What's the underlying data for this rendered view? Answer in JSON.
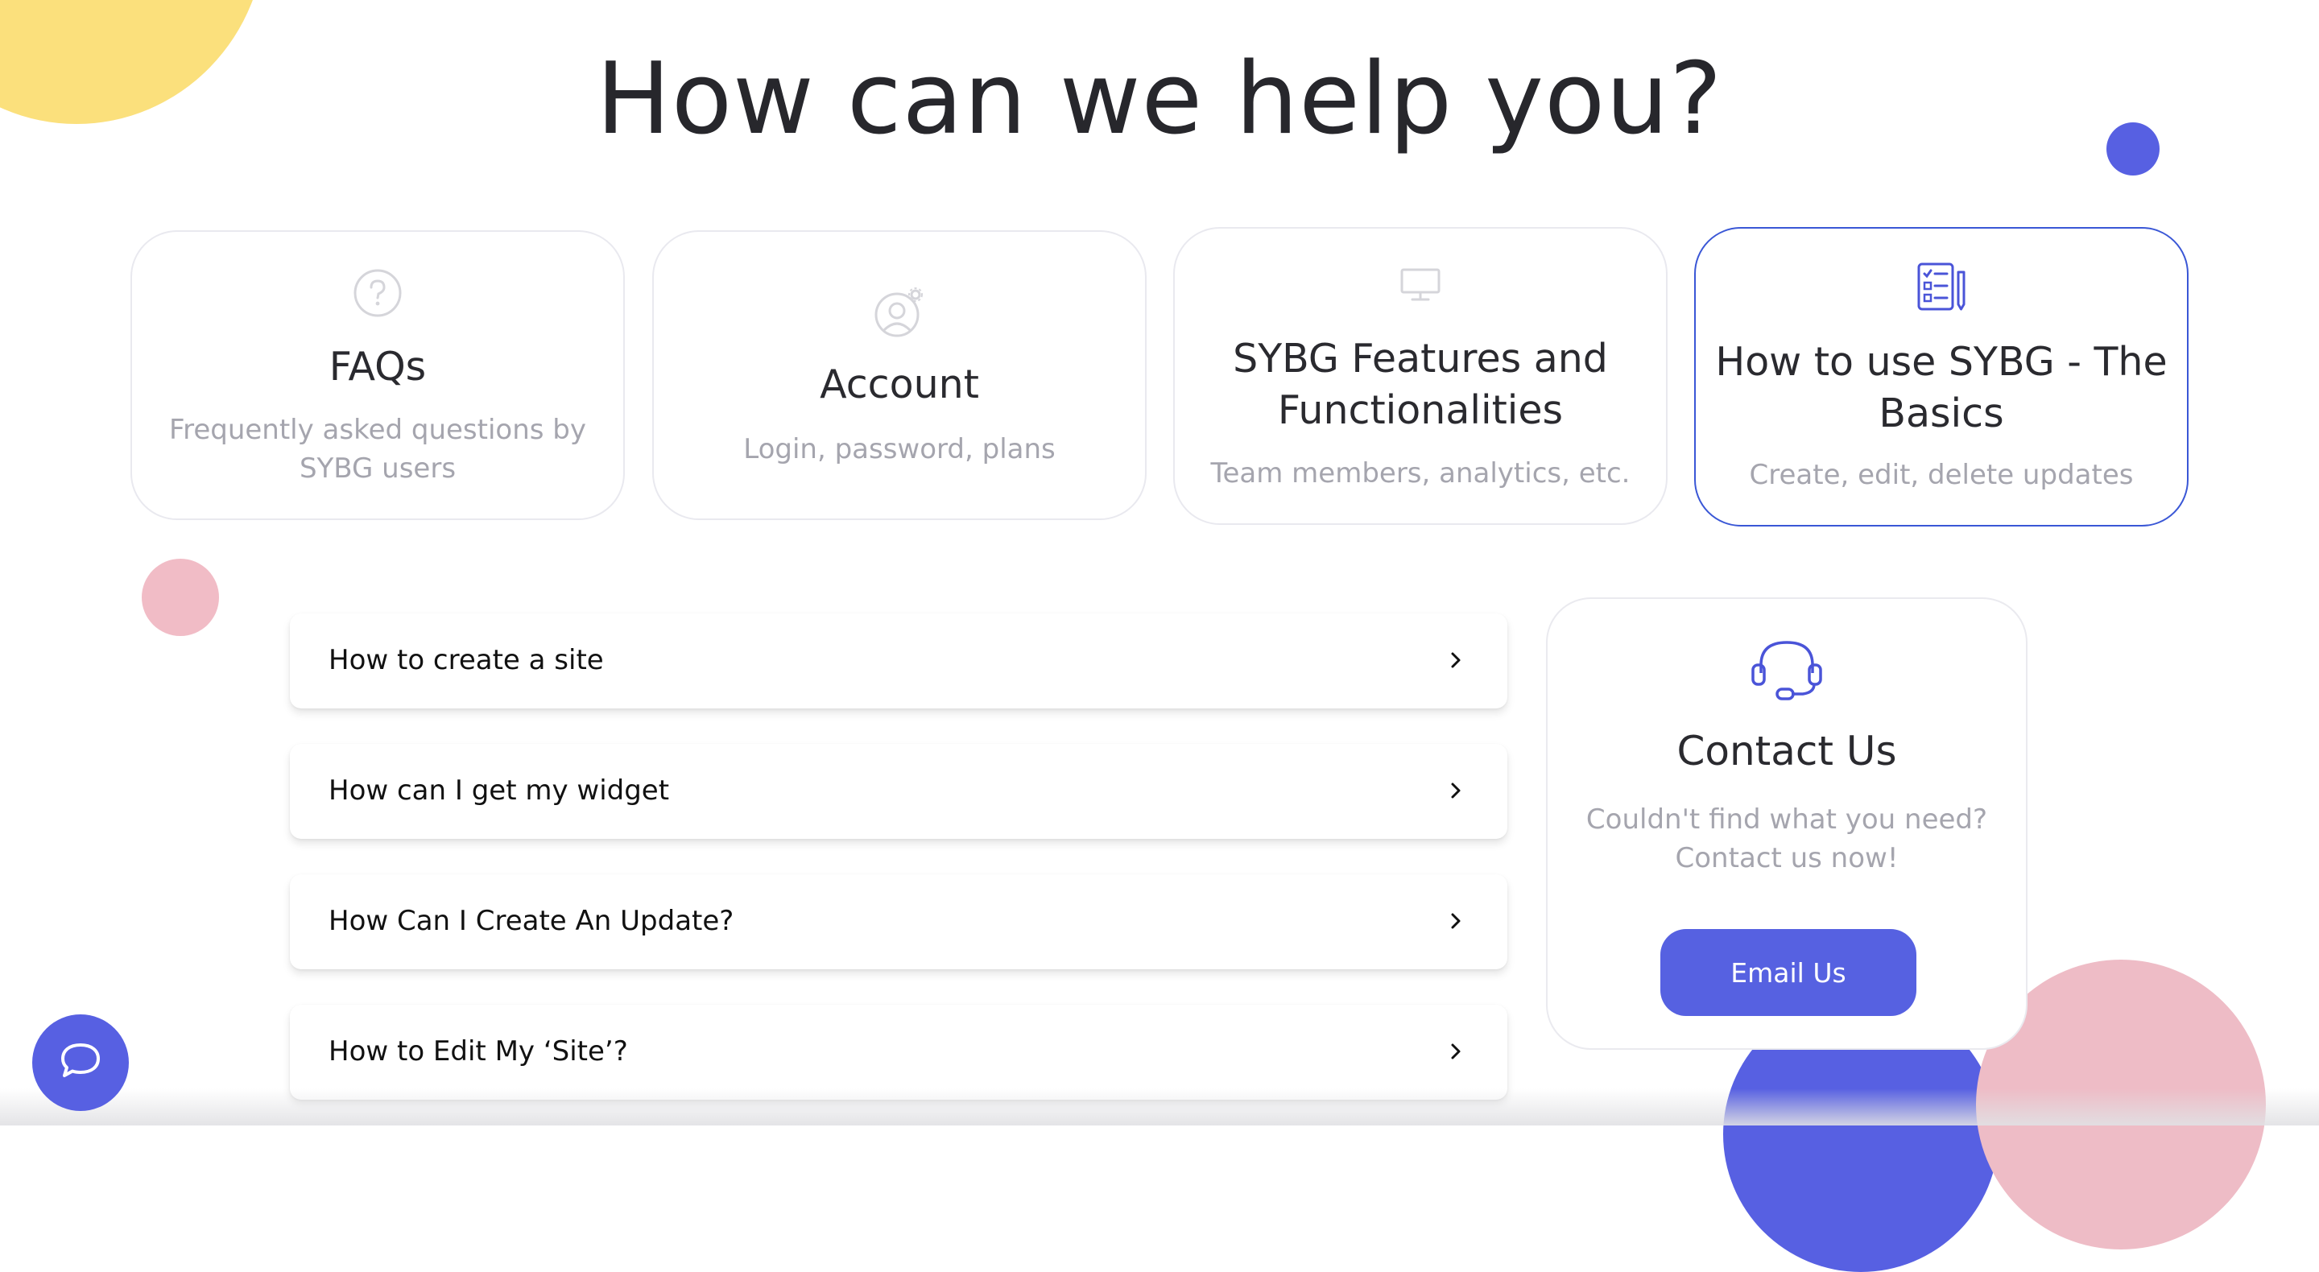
{
  "page": {
    "title": "How can we help you?"
  },
  "categories": [
    {
      "icon": "question-circle-icon",
      "title": "FAQs",
      "subtitle": "Frequently asked questions by SYBG users",
      "active": false
    },
    {
      "icon": "user-settings-icon",
      "title": "Account",
      "subtitle": "Login, password, plans",
      "active": false
    },
    {
      "icon": "monitor-icon",
      "title": "SYBG Features and Functionalities",
      "subtitle": "Team members, analytics, etc.",
      "active": false
    },
    {
      "icon": "checklist-pencil-icon",
      "title": "How to use SYBG - The Basics",
      "subtitle": "Create, edit, delete updates",
      "active": true
    }
  ],
  "faq_items": [
    {
      "question": "How to create a site"
    },
    {
      "question": "How can I get my widget"
    },
    {
      "question": "How Can I Create An Update?"
    },
    {
      "question": "How to Edit My ‘Site’?"
    }
  ],
  "contact": {
    "icon": "headset-icon",
    "title": "Contact Us",
    "subtitle": "Couldn't find what you need? Contact us now!",
    "button_label": "Email Us"
  },
  "chat": {
    "icon": "chat-bubble-icon"
  },
  "colors": {
    "accent": "#5760e2",
    "active_border": "#3a57d6",
    "yellow": "#fbe07c",
    "pink": "#eebcc6",
    "muted_text": "#a5a5ae"
  }
}
